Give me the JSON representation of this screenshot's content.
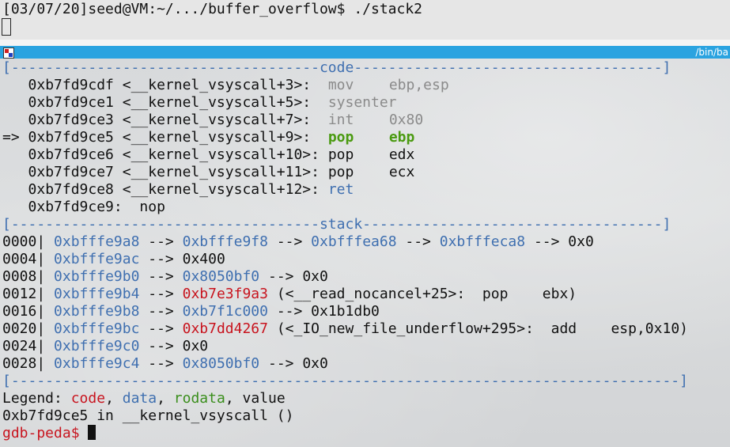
{
  "shell": {
    "prompt_line": "[03/07/20]seed@VM:~/.../buffer_overflow$ ./stack2"
  },
  "window": {
    "title": "/bin/ba"
  },
  "code_section": {
    "header_left": "[------------------------------------",
    "header_label": "code",
    "header_right": "------------------------------------]",
    "lines": [
      {
        "marker": "   ",
        "addr": "0xb7fd9cdf",
        "sym": " <__kernel_vsyscall+3>:  ",
        "op": "mov",
        "args": "ebp,esp",
        "style": "grey"
      },
      {
        "marker": "   ",
        "addr": "0xb7fd9ce1",
        "sym": " <__kernel_vsyscall+5>:  ",
        "op": "sysenter",
        "args": "",
        "style": "grey"
      },
      {
        "marker": "   ",
        "addr": "0xb7fd9ce3",
        "sym": " <__kernel_vsyscall+7>:  ",
        "op": "int",
        "args": "0x80",
        "style": "grey"
      },
      {
        "marker": "=> ",
        "addr": "0xb7fd9ce5",
        "sym": " <__kernel_vsyscall+9>:  ",
        "op": "pop",
        "args": "ebp",
        "style": "current"
      },
      {
        "marker": "   ",
        "addr": "0xb7fd9ce6",
        "sym": " <__kernel_vsyscall+10>: ",
        "op": "pop",
        "args": "edx",
        "style": "normal"
      },
      {
        "marker": "   ",
        "addr": "0xb7fd9ce7",
        "sym": " <__kernel_vsyscall+11>: ",
        "op": "pop",
        "args": "ecx",
        "style": "normal"
      },
      {
        "marker": "   ",
        "addr": "0xb7fd9ce8",
        "sym": " <__kernel_vsyscall+12>: ",
        "op": "ret",
        "args": "",
        "style": "blue"
      },
      {
        "marker": "   ",
        "addr": "0xb7fd9ce9",
        "sym": ":  ",
        "op": "nop",
        "args": "",
        "style": "plain"
      }
    ]
  },
  "stack_section": {
    "header_left": "[------------------------------------",
    "header_label": "stack",
    "header_right": "-----------------------------------]",
    "rows": [
      {
        "offset": "0000",
        "parts": [
          [
            "blue",
            "0xbfffe9a8"
          ],
          [
            "plain",
            " --> "
          ],
          [
            "blue",
            "0xbfffe9f8"
          ],
          [
            "plain",
            " --> "
          ],
          [
            "blue",
            "0xbfffea68"
          ],
          [
            "plain",
            " --> "
          ],
          [
            "blue",
            "0xbfffeca8"
          ],
          [
            "plain",
            " --> 0x0"
          ]
        ]
      },
      {
        "offset": "0004",
        "parts": [
          [
            "blue",
            "0xbfffe9ac"
          ],
          [
            "plain",
            " --> 0x400"
          ]
        ]
      },
      {
        "offset": "0008",
        "parts": [
          [
            "blue",
            "0xbfffe9b0"
          ],
          [
            "plain",
            " --> "
          ],
          [
            "blue",
            "0x8050bf0"
          ],
          [
            "plain",
            " --> 0x0"
          ]
        ]
      },
      {
        "offset": "0012",
        "parts": [
          [
            "blue",
            "0xbfffe9b4"
          ],
          [
            "plain",
            " --> "
          ],
          [
            "red",
            "0xb7e3f9a3"
          ],
          [
            "plain",
            " (<__read_nocancel+25>:  pop    ebx)"
          ]
        ]
      },
      {
        "offset": "0016",
        "parts": [
          [
            "blue",
            "0xbfffe9b8"
          ],
          [
            "plain",
            " --> "
          ],
          [
            "blue",
            "0xb7f1c000"
          ],
          [
            "plain",
            " --> 0x1b1db0"
          ]
        ]
      },
      {
        "offset": "0020",
        "parts": [
          [
            "blue",
            "0xbfffe9bc"
          ],
          [
            "plain",
            " --> "
          ],
          [
            "red",
            "0xb7dd4267"
          ],
          [
            "plain",
            " (<_IO_new_file_underflow+295>:  add    esp,0x10)"
          ]
        ]
      },
      {
        "offset": "0024",
        "parts": [
          [
            "blue",
            "0xbfffe9c0"
          ],
          [
            "plain",
            " --> 0x0"
          ]
        ]
      },
      {
        "offset": "0028",
        "parts": [
          [
            "blue",
            "0xbfffe9c4"
          ],
          [
            "plain",
            " --> "
          ],
          [
            "blue",
            "0x8050bf0"
          ],
          [
            "plain",
            " --> 0x0"
          ]
        ]
      }
    ]
  },
  "footer_rule": "[------------------------------------------------------------------------------]",
  "legend": {
    "label": "Legend: ",
    "code": "code",
    "sep1": ", ",
    "data": "data",
    "sep2": ", ",
    "rodata": "rodata",
    "sep3": ", ",
    "value": "value"
  },
  "status_line": "0xb7fd9ce5 in __kernel_vsyscall ()",
  "gdb_prompt": "gdb-peda$ ",
  "colors": {
    "titlebar": "#2aa3e0",
    "address_blue": "#3f6fb0",
    "code_red": "#c8141e",
    "rodata_green": "#3a8e1c",
    "current_instr_green": "#4a9a10",
    "dim_grey": "#8a8a8a"
  },
  "icons": {
    "window_icon": "terminal-app-icon",
    "cursor": "block-cursor"
  }
}
